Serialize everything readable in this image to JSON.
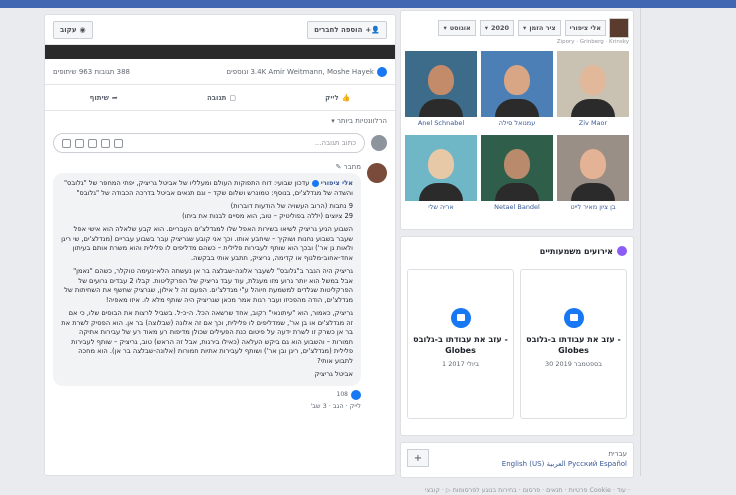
{
  "feed": {
    "follow_label": "עקוב",
    "add_friend_label": "הוספה לחברים",
    "stats": {
      "names": "3.4K Amir Weitmann, Moshe Hayek ונוספים",
      "counts": "388 תגובות 963 שיתופים"
    },
    "actions": {
      "like": "לייק",
      "comment": "תגובה",
      "share": "שיתוף"
    },
    "relevance": "הרלוונטיות ביותר ▾",
    "composer_placeholder": "כתוב תגובה...",
    "comment": {
      "author_line": "מחבר ✎",
      "author": "אלי ציפורי",
      "paragraphs": [
        "עדכון שבועי: דוח התפוקות העולם ומעלליו של אביטל גריציק, יפתי המחפר של \"גלובס\" והשדה של מגדלצ'ים, בנוסף: טמונרש ושלום שקד – וגם תנאים אביטל בדרכה הכבודה של \"גלובס\"",
        "9 נתבות (הרוב העשויה של הודעות דוברות)",
        "29 ציוצים (יללה בפוליטיק – טוב, הוא מסיים לבנות את ביתו)",
        "השבוע הגיע גריציק לשיאו בשירות האפל שלו למגדלצ'ים העבריים. הוא קבע שלאלה הוא אישי אפל שעבר בשבוע נחנות ושוקיך – שיחבע אותו. וכך אני קובע שגריציק עבר בשבוע עבריים (מגדלצ'ים, שי ריגן ולאות גן אר') ובכך הוא שותף לעבירות פלילית – כשהם מדליפים לו פלילית והוא משרת אותם בעיתון אחד-אחוב-מלנוף או קדימה, גריציק, תתבע אותי בבקשה.",
        "גריציק היה הנבר ב\"גלובס\" לשעבר אלונה-שבלצה בר אן נעשתה הלא-נעימה טוקלר, כשהם \"נאמן\" אבל במשל הוא יותר גרוע מזו מעגלת, עוד עבד גריציק של הפרקליטות. קבלו 2 עבדים גרועים של הפרקליטות שגלדים למשמעת חיוהל ע\"י מגדלצ'ים. הפעם זה ל אילון, שגרציק שחשף את השחיתות של מגדלצ'ים, הודה מהפכיזו ועבר רגות אמר מכאן שגריציק היה שותף מלא לו. איזו מאפיה!",
        "גריציק, כאמור, הוא \"עיתונאי\" רקוב, אחד שרשאה הכל. ה-כ-ל. בשביל לרצות את הבוסים שלו, כי אם זה מגדלצ'ים או בן אר', שמדליפים לו פלילית, וכך אם זה אלונה (שבלוצה) בר אן. הוא הפסיק לשרת את בר אן כשרק זו לשרת ידעה על פיטום כנת הפעילים שכולן מדיפות רע מאוד רע של עבירות אתיקה חמורות – והשבוע הוא גם ביקש העלאה (כאילו בירגות, אבל זה הראש) טוב, גריציק – שותף לעבירות פלילית (מגדלצ'ים, ריגן ובן אר') ושותף לעבירות אתיות חמורות (אלונה-שבלצה בר אן). הוא מחכה לתבוע אותי?"
      ],
      "reaction_count": "108",
      "signature": "אביטל גריציק",
      "meta": "לייק · הגב · 3 שב'"
    }
  },
  "side": {
    "header": {
      "month": "אוגוסט",
      "year": "2020",
      "timeline": "ציר הזמן",
      "name": "אלי ציפורי",
      "subname": "Zipory · Grinberg · Krinsky"
    },
    "photos": [
      {
        "caption": "Anel Schnabel",
        "bg": "#3d6b8a",
        "skin": "#c48b6a"
      },
      {
        "caption": "עמנואל סילה",
        "bg": "#4b7fb5",
        "skin": "#d8a585"
      },
      {
        "caption": "Ziv Maor",
        "bg": "#c9c2b3",
        "skin": "#e2b89a"
      },
      {
        "caption": "אריה שלי",
        "bg": "#6fb6c6",
        "skin": "#e8c9a7"
      },
      {
        "caption": "Netael Bandel",
        "bg": "#2f5e4a",
        "skin": "#b98a6c"
      },
      {
        "caption": "בן ציון מאיר לייט",
        "bg": "#9a8f86",
        "skin": "#e4b295"
      }
    ],
    "events_title": "אירועים משמעותיים",
    "events": [
      {
        "title": "עזב את עבודתו ב-גלובס - Globes",
        "date": "30 בספטמבר 2019"
      },
      {
        "title": "עזב את עבודתו ב-גלובס - Globes",
        "date": "1 ביולי 2017"
      }
    ],
    "languages": {
      "current": "עברית",
      "others": "English (US)  العربية  Русский  Español"
    },
    "footer": "פרטיות · תנאים · פרסום · בחירות בנוגע לפרסומות ▷ · קובצי Cookie · עוד ·"
  }
}
